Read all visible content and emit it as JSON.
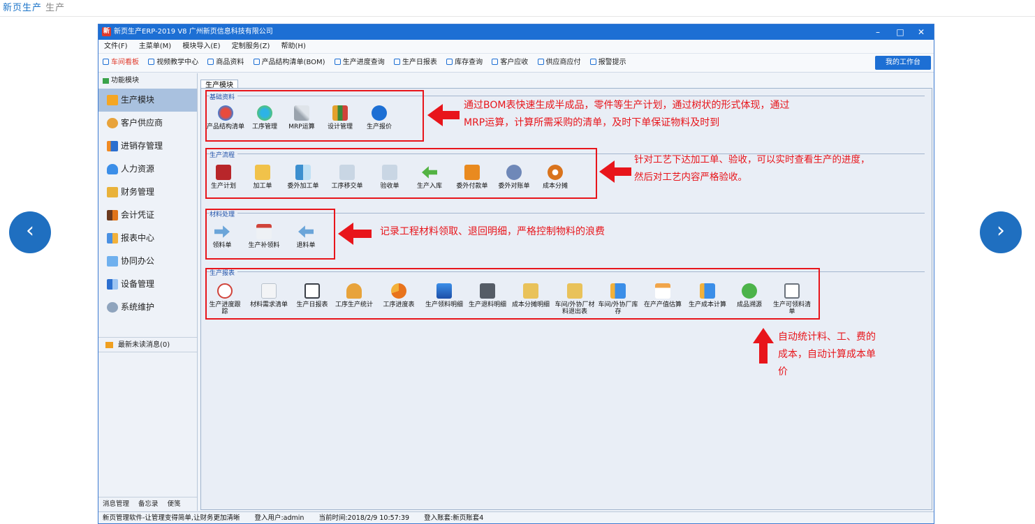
{
  "top_strip": {
    "crumb_blue": "新页生产",
    "crumb_gray": "生产"
  },
  "window": {
    "title": "新页生产ERP-2019 V8 广州新页信息科技有限公司",
    "controls": {
      "minimize": "–",
      "maximize": "□",
      "close": "✕"
    }
  },
  "menus": [
    "文件(F)",
    "主菜单(M)",
    "模块导入(E)",
    "定制服务(Z)",
    "帮助(H)"
  ],
  "toolbar": {
    "items": [
      "车间看板",
      "视频教学中心",
      "商品资料",
      "产品结构清单(BOM)",
      "生产进度查询",
      "生产日报表",
      "库存查询",
      "客户应收",
      "供应商应付",
      "报警提示"
    ],
    "workbench": "我的工作台"
  },
  "sidebar": {
    "header": "功能模块",
    "items": [
      "生产模块",
      "客户供应商",
      "进销存管理",
      "人力资源",
      "财务管理",
      "会计凭证",
      "报表中心",
      "协同办公",
      "设备管理",
      "系统维护"
    ],
    "news": "最新未读消息(0)",
    "bottom": [
      "消息管理",
      "备忘录",
      "便笺"
    ]
  },
  "tab": "生产模块",
  "sections": [
    {
      "title": "基础资料",
      "items": [
        "产品结构清单",
        "工序管理",
        "MRP运算",
        "设计管理",
        "生产报价"
      ]
    },
    {
      "title": "生产流程",
      "items": [
        "生产计划",
        "加工单",
        "委外加工单",
        "工序移交单",
        "验收单",
        "生产入库",
        "委外付款单",
        "委外对账单",
        "成本分摊"
      ]
    },
    {
      "title": "材料处理",
      "items": [
        "领料单",
        "生产补领料",
        "退料单"
      ]
    },
    {
      "title": "生产报表",
      "items": [
        "生产进度跟踪",
        "材料需求清单",
        "生产日报表",
        "工序生产统计",
        "工序进度表",
        "生产领料明细",
        "生产退料明细",
        "成本分摊明细",
        "车间/外协厂材料退出表",
        "车间/外协厂库存",
        "在产产值估算",
        "生产成本计算",
        "成品溯源",
        "生产可领料清单"
      ]
    }
  ],
  "annotations": {
    "a1_line1": "通过BOM表快速生成半成品，零件等生产计划，通过树状的形式体现，通过",
    "a1_line2": "MRP运算，计算所需采购的清单，及时下单保证物料及时到",
    "a2_line1": "针对工艺下达加工单、验收，可以实时查看生产的进度，",
    "a2_line2": "然后对工艺内容严格验收。",
    "a3": "记录工程材料领取、退回明细，严格控制物料的浪费",
    "a4_line1": "自动统计料、工、费的",
    "a4_line2": "成本，自动计算成本单",
    "a4_line3": "价"
  },
  "status": {
    "slogan": "新页管理软件-让管理变得简单,让财务更加清晰",
    "user": "登入用户:admin",
    "time": "当前时间:2018/2/9 10:57:39",
    "account": "登入账套:新页账套4"
  },
  "colors": {
    "accent": "#1d6fd4",
    "annotation": "#e8151b",
    "nav_circle": "#1f6fc0"
  }
}
